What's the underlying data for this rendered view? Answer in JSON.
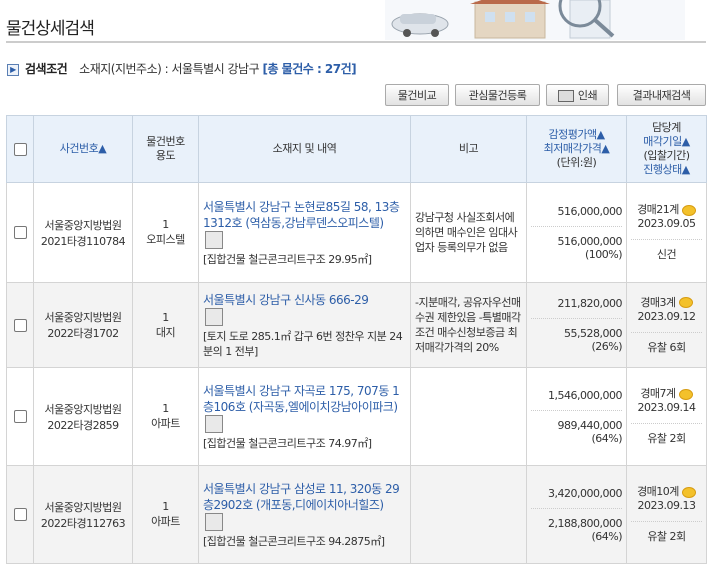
{
  "header": {
    "title": "물건상세검색"
  },
  "criteria": {
    "label": "검색조건",
    "location": "소재지(지번주소) : 서울특별시 강남구",
    "count_text": "[총 물건수 : 27건]"
  },
  "buttons": {
    "compare": "물건비교",
    "register": "관심물건등록",
    "print": "인쇄",
    "refine": "결과내재검색"
  },
  "columns": {
    "case_no": "사건번호▲",
    "item_no": "물건번호",
    "usage": "용도",
    "location": "소재지 및 내역",
    "remarks": "비고",
    "appraisal": "감정평가액▲",
    "min_price": "최저매각가격▲",
    "unit": "(단위:원)",
    "dept": "담당계",
    "sale_date": "매각기일▲",
    "bid_period": "(입찰기간)",
    "progress": "진행상태▲"
  },
  "rows": [
    {
      "court": "서울중앙지방법원",
      "case": "2021타경110784",
      "item_no": "1",
      "usage": "오피스텔",
      "address": "서울특별시 강남구 논현로85길 58, 13층1312호 (역삼동,강남루덴스오피스텔)",
      "detail": "[집합건물 철근콘크리트구조 29.95㎡]",
      "remarks": "강남구청 사실조회서에 의하면 매수인은 임대사업자 등록의무가 없음",
      "appraisal": "516,000,000",
      "min_price": "516,000,000",
      "ratio": "(100%)",
      "dept": "경매21계",
      "date": "2023.09.05",
      "status": "신건"
    },
    {
      "court": "서울중앙지방법원",
      "case": "2022타경1702",
      "item_no": "1",
      "usage": "대지",
      "address": "서울특별시 강남구 신사동 666-29",
      "detail": "[토지 도로 285.1㎡ 갑구 6번 정찬우 지분 24분의 1 전부]",
      "remarks": "-지분매각, 공유자우선매수권 제한있음 -특별매각조건 매수신청보증금 최저매각가격의 20%",
      "appraisal": "211,820,000",
      "min_price": "55,528,000",
      "ratio": "(26%)",
      "dept": "경매3계",
      "date": "2023.09.12",
      "status": "유찰 6회"
    },
    {
      "court": "서울중앙지방법원",
      "case": "2022타경2859",
      "item_no": "1",
      "usage": "아파트",
      "address": "서울특별시 강남구 자곡로 175, 707동 1층106호 (자곡동,엘에이치강남아이파크)",
      "detail": "[집합건물 철근콘크리트구조 74.97㎡]",
      "remarks": "",
      "appraisal": "1,546,000,000",
      "min_price": "989,440,000",
      "ratio": "(64%)",
      "dept": "경매7계",
      "date": "2023.09.14",
      "status": "유찰 2회"
    },
    {
      "court": "서울중앙지방법원",
      "case": "2022타경112763",
      "item_no": "1",
      "usage": "아파트",
      "address": "서울특별시 강남구 삼성로 11, 320동 29층2902호 (개포동,디에이치아너힐즈)",
      "detail": "[집합건물 철근콘크리트구조 94.2875㎡]",
      "remarks": "",
      "appraisal": "3,420,000,000",
      "min_price": "2,188,800,000",
      "ratio": "(64%)",
      "dept": "경매10계",
      "date": "2023.09.13",
      "status": "유찰 2회"
    }
  ]
}
